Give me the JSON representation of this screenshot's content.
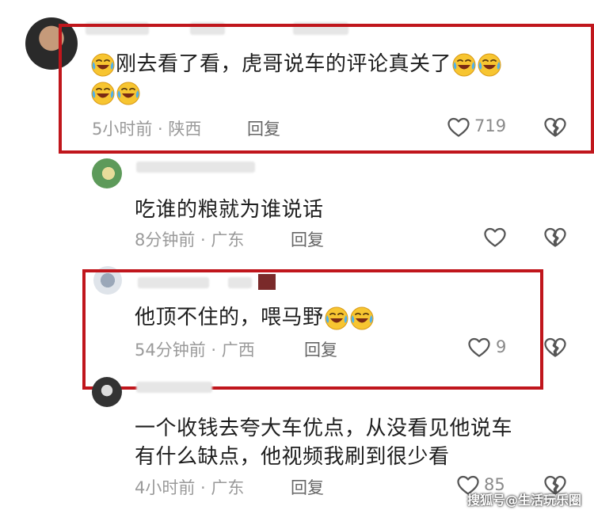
{
  "comments": [
    {
      "text": "刚去看了看，虎哥说车的评论真关了",
      "emoji_count_inline": 2,
      "emoji_count_line2": 2,
      "meta": "5小时前 · 陕西",
      "reply": "回复",
      "likes": "719"
    },
    {
      "text": "吃谁的粮就为谁说话",
      "meta": "8分钟前 · 广东",
      "reply": "回复",
      "likes": ""
    },
    {
      "text": "他顶不住的，喂马野",
      "emoji_count_inline": 2,
      "meta": "54分钟前 · 广西",
      "reply": "回复",
      "likes": "9"
    },
    {
      "text_line1": "一个收钱去夸大车优点，从没看见他说车",
      "text_line2": "有什么缺点，他视频我刷到很少看",
      "meta": "4小时前 · 广东",
      "reply": "回复",
      "likes": "85"
    }
  ],
  "watermark": "搜狐号@生活玩乐圈",
  "icons": {
    "like": "heart-outline-icon",
    "dislike": "broken-heart-icon",
    "emoji": "laughing-crying-emoji-icon"
  },
  "colors": {
    "highlight_box": "#c0161c",
    "meta_text": "#9a9a9a"
  }
}
